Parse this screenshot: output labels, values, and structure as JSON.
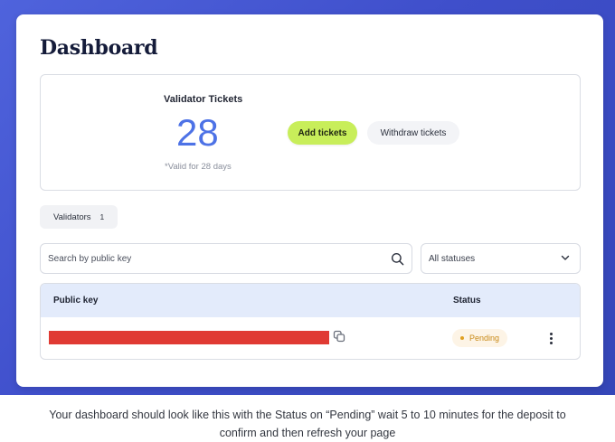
{
  "dashboard": {
    "title": "Dashboard",
    "tickets": {
      "label": "Validator Tickets",
      "count": "28",
      "note": "*Valid for 28 days",
      "add_button": "Add tickets",
      "withdraw_button": "Withdraw tickets"
    },
    "validators_tab": {
      "label": "Validators",
      "count": "1"
    },
    "search": {
      "placeholder": "Search by public key"
    },
    "status_filter": {
      "selected": "All statuses"
    },
    "table": {
      "columns": [
        "Public key",
        "Status"
      ],
      "rows": [
        {
          "status": "Pending"
        }
      ]
    }
  },
  "caption": {
    "line1": "Your dashboard should look like this with the Status on “Pending” wait 5 to 10 minutes for the deposit to",
    "line2": "confirm and then refresh your page"
  },
  "colors": {
    "frame_background": "#4a5ed6",
    "add_button": "#c8ee5a",
    "ticket_count": "#4d72e6",
    "table_header": "#e3ebfb",
    "pending": "#e0a021",
    "redacted_key": "#e03a33"
  },
  "icons": [
    "search-icon",
    "chevron-down-icon",
    "copy-icon",
    "more-vertical-icon"
  ]
}
